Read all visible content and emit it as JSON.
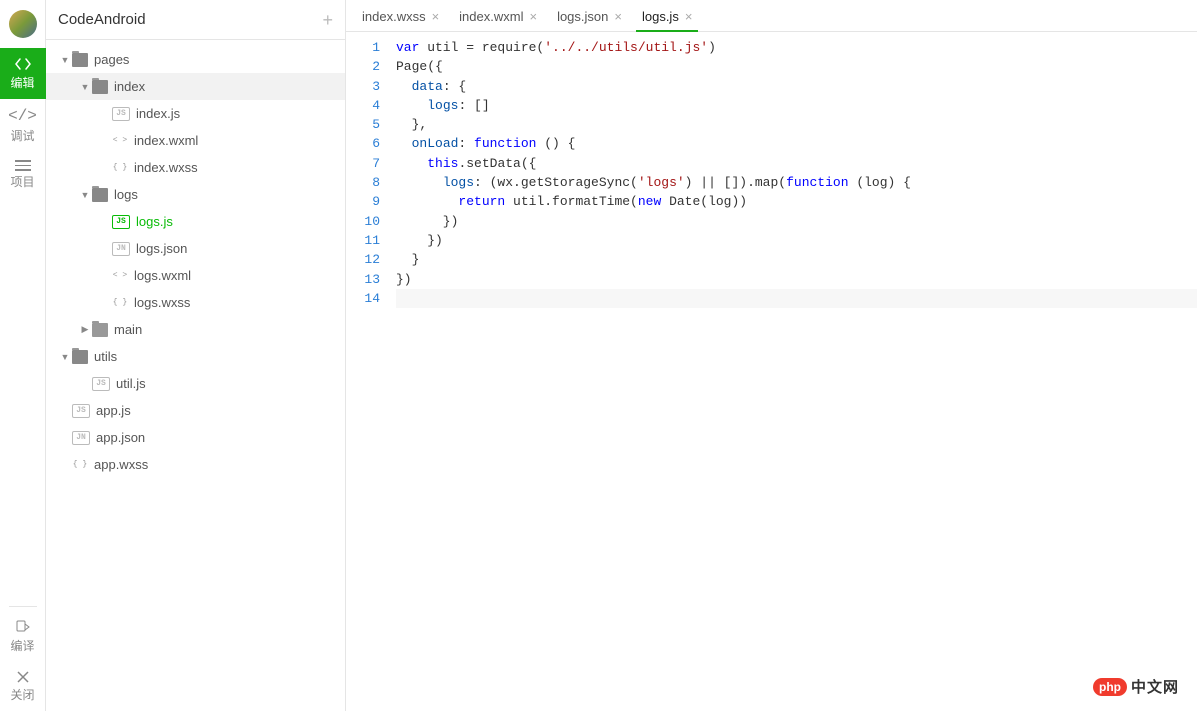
{
  "project": {
    "name": "CodeAndroid"
  },
  "rail": {
    "edit": {
      "label": "编辑"
    },
    "debug": {
      "label": "调试"
    },
    "proj": {
      "label": "项目"
    },
    "compile": {
      "label": "编译"
    },
    "close": {
      "label": "关闭"
    }
  },
  "tree": {
    "pages": {
      "name": "pages",
      "index": {
        "name": "index",
        "js": "index.js",
        "wxml": "index.wxml",
        "wxss": "index.wxss"
      },
      "logs": {
        "name": "logs",
        "js": "logs.js",
        "json": "logs.json",
        "wxml": "logs.wxml",
        "wxss": "logs.wxss"
      },
      "main": {
        "name": "main"
      }
    },
    "utils": {
      "name": "utils",
      "js": "util.js"
    },
    "app_js": "app.js",
    "app_json": "app.json",
    "app_wxss": "app.wxss"
  },
  "icons": {
    "js": "JS",
    "json": "JN",
    "wxml": "< >",
    "wxss": "{ }"
  },
  "tabs": [
    {
      "label": "index.wxss",
      "active": false
    },
    {
      "label": "index.wxml",
      "active": false
    },
    {
      "label": "logs.json",
      "active": false
    },
    {
      "label": "logs.js",
      "active": true
    }
  ],
  "code": {
    "lines": [
      {
        "n": 1,
        "seg": [
          [
            "k-blue",
            "var"
          ],
          [
            "",
            " util = require("
          ],
          [
            "k-str",
            "'../../utils/util.js'"
          ],
          [
            "",
            ")"
          ]
        ]
      },
      {
        "n": 2,
        "seg": [
          [
            "",
            "Page({"
          ]
        ]
      },
      {
        "n": 3,
        "seg": [
          [
            "",
            "  "
          ],
          [
            "k-prop",
            "data"
          ],
          [
            "",
            ": {"
          ]
        ]
      },
      {
        "n": 4,
        "seg": [
          [
            "",
            "    "
          ],
          [
            "k-prop",
            "logs"
          ],
          [
            "",
            ": []"
          ]
        ]
      },
      {
        "n": 5,
        "seg": [
          [
            "",
            "  },"
          ]
        ]
      },
      {
        "n": 6,
        "seg": [
          [
            "",
            "  "
          ],
          [
            "k-prop",
            "onLoad"
          ],
          [
            "",
            ": "
          ],
          [
            "k-blue",
            "function"
          ],
          [
            "",
            " () {"
          ]
        ]
      },
      {
        "n": 7,
        "seg": [
          [
            "",
            "    "
          ],
          [
            "k-blue",
            "this"
          ],
          [
            "",
            ".setData({"
          ]
        ]
      },
      {
        "n": 8,
        "seg": [
          [
            "",
            "      "
          ],
          [
            "k-prop",
            "logs"
          ],
          [
            "",
            ": (wx.getStorageSync("
          ],
          [
            "k-str",
            "'logs'"
          ],
          [
            "",
            ") || []).map("
          ],
          [
            "k-blue",
            "function"
          ],
          [
            "",
            " (log) {"
          ]
        ]
      },
      {
        "n": 9,
        "seg": [
          [
            "",
            "        "
          ],
          [
            "k-blue",
            "return"
          ],
          [
            "",
            " util.formatTime("
          ],
          [
            "k-blue",
            "new"
          ],
          [
            "",
            " Date(log))"
          ]
        ]
      },
      {
        "n": 10,
        "seg": [
          [
            "",
            "      })"
          ]
        ]
      },
      {
        "n": 11,
        "seg": [
          [
            "",
            "    })"
          ]
        ]
      },
      {
        "n": 12,
        "seg": [
          [
            "",
            "  }"
          ]
        ]
      },
      {
        "n": 13,
        "seg": [
          [
            "",
            "})"
          ]
        ]
      },
      {
        "n": 14,
        "seg": [
          [
            "",
            ""
          ]
        ]
      }
    ]
  },
  "watermark": {
    "badge": "php",
    "text": "中文网"
  }
}
